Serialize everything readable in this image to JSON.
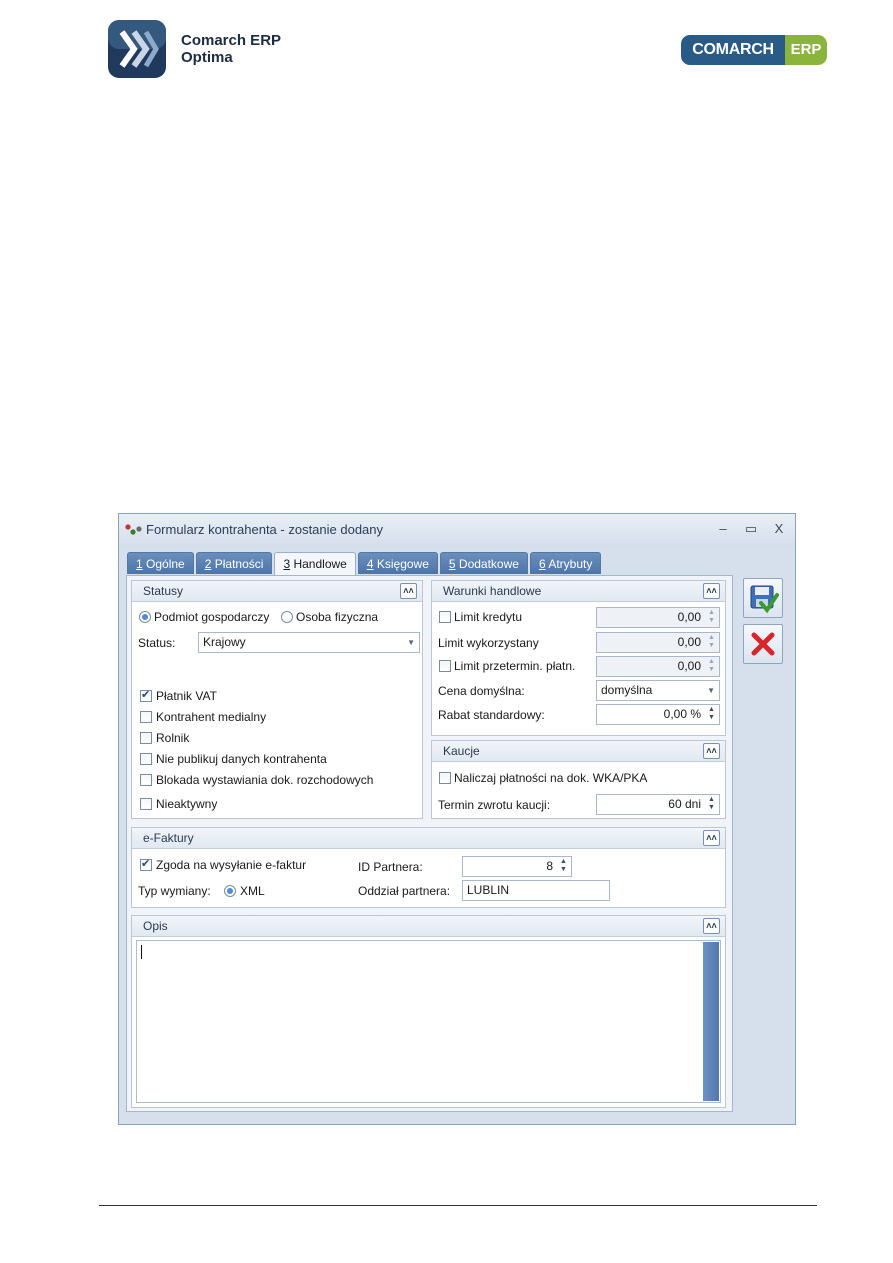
{
  "header": {
    "left_logo_line1": "Comarch ERP",
    "left_logo_line2": "Optima",
    "right_logo_main": "COMARCH",
    "right_logo_badge": "ERP"
  },
  "window": {
    "title": "Formularz kontrahenta - zostanie dodany",
    "controls": {
      "minimize": "–",
      "maximize": "▭",
      "close": "X"
    }
  },
  "tabs": [
    {
      "num": "1",
      "label": " Ogólne"
    },
    {
      "num": "2",
      "label": " Płatności"
    },
    {
      "num": "3",
      "label": " Handlowe"
    },
    {
      "num": "4",
      "label": " Księgowe"
    },
    {
      "num": "5",
      "label": " Dodatkowe"
    },
    {
      "num": "6",
      "label": " Atrybuty"
    }
  ],
  "statusy": {
    "title": "Statusy",
    "radio_podmiot": "Podmiot gospodarczy",
    "radio_osoba": "Osoba fizyczna",
    "status_label": "Status:",
    "status_value": "Krajowy",
    "platnik_vat": "Płatnik VAT",
    "kontrahent_medialny": "Kontrahent medialny",
    "rolnik": "Rolnik",
    "nie_publikuj": "Nie publikuj danych kontrahenta",
    "blokada": "Blokada wystawiania dok. rozchodowych",
    "nieaktywny": "Nieaktywny"
  },
  "warunki": {
    "title": "Warunki handlowe",
    "limit_kredytu": "Limit kredytu",
    "limit_kredytu_value": "0,00",
    "limit_wykorzystany": "Limit wykorzystany",
    "limit_wykorzystany_value": "0,00",
    "limit_przetermin": "Limit przetermin. płatn.",
    "limit_przetermin_value": "0,00",
    "cena_label": "Cena domyślna:",
    "cena_value": "domyślna",
    "rabat_label": "Rabat standardowy:",
    "rabat_value": "0,00 %"
  },
  "kaucje": {
    "title": "Kaucje",
    "naliczaj": "Naliczaj płatności na dok. WKA/PKA",
    "termin_label": "Termin zwrotu kaucji:",
    "termin_value": "60 dni"
  },
  "efaktury": {
    "title": "e-Faktury",
    "zgoda": "Zgoda na wysyłanie e-faktur",
    "typ_label": "Typ wymiany:",
    "typ_value": "XML",
    "id_label": "ID Partnera:",
    "id_value": "8",
    "oddzial_label": "Oddział partnera:",
    "oddzial_value": "LUBLIN"
  },
  "opis": {
    "title": "Opis"
  },
  "icons": {
    "collapse": "chevron-double-up-icon",
    "save": "save-disk-check-icon",
    "cancel": "red-x-icon"
  },
  "colors": {
    "tab_inactive": "#5a7fb0",
    "window_bg": "#d6e0ed",
    "cancel_red": "#d8242a",
    "brand_blue": "#2a5a86",
    "brand_green": "#8ab43c"
  }
}
